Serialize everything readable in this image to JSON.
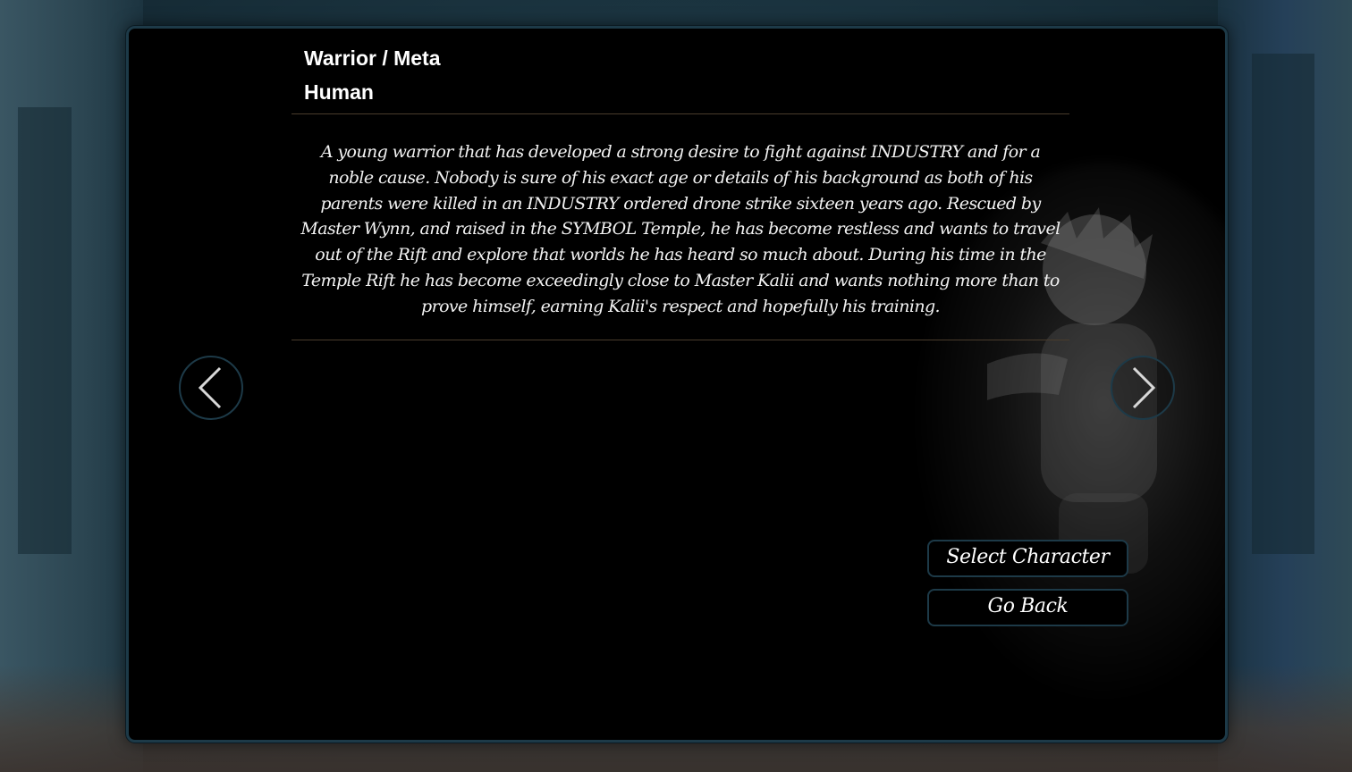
{
  "character": {
    "class_label": "Warrior / Meta",
    "race_label": "Human",
    "description": "A young warrior that has developed a strong desire to fight against INDUSTRY and for a noble cause. Nobody is sure of his exact age or details of his background as both of his parents were killed in an INDUSTRY ordered drone strike sixteen years ago. Rescued by Master Wynn, and raised in the SYMBOL Temple, he has become restless and wants to travel out of the Rift and explore that worlds he has heard so much about. During his time in the Temple Rift he has become exceedingly close to Master Kalii and wants nothing more than to prove himself, earning Kalii's respect and hopefully his training."
  },
  "navigation": {
    "prev_icon": "chevron-left-icon",
    "next_icon": "chevron-right-icon"
  },
  "actions": {
    "select_label": "Select Character",
    "back_label": "Go Back"
  },
  "colors": {
    "panel_background": "#000000",
    "panel_border": "#1d3a48",
    "divider": "#4a3c2c",
    "text": "#ffffff"
  }
}
